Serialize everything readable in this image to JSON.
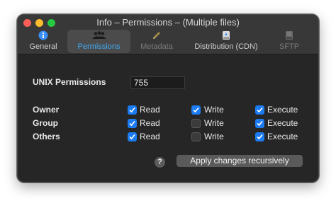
{
  "window": {
    "title": "Info – Permissions – (Multiple files)"
  },
  "toolbar": {
    "tabs": [
      {
        "label": "General",
        "icon": "info-icon",
        "state": "normal"
      },
      {
        "label": "Permissions",
        "icon": "users-icon",
        "state": "active"
      },
      {
        "label": "Metadata",
        "icon": "pencil-icon",
        "state": "disabled"
      },
      {
        "label": "Distribution (CDN)",
        "icon": "drive-icon",
        "state": "normal"
      },
      {
        "label": "SFTP",
        "icon": "server-icon",
        "state": "disabled"
      }
    ]
  },
  "permissions": {
    "unix_label": "UNIX Permissions",
    "unix_value": "755",
    "columns": [
      "Read",
      "Write",
      "Execute"
    ],
    "rows": [
      {
        "label": "Owner",
        "read": true,
        "write": true,
        "execute": true
      },
      {
        "label": "Group",
        "read": true,
        "write": false,
        "execute": true
      },
      {
        "label": "Others",
        "read": true,
        "write": false,
        "execute": true
      }
    ]
  },
  "footer": {
    "help_label": "?",
    "apply_label": "Apply changes recursively"
  },
  "colors": {
    "accent": "#1b7bf2",
    "active_tab_text": "#3fa9f5",
    "window_bg": "#262626"
  }
}
